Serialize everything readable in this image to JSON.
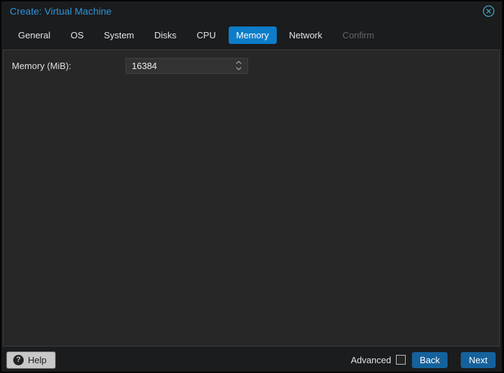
{
  "window": {
    "title": "Create: Virtual Machine"
  },
  "icons": {
    "close": "circle-x",
    "help": "question-circle",
    "spinner_up": "chevron-up",
    "spinner_down": "chevron-down"
  },
  "tabs": [
    {
      "label": "General",
      "state": "normal"
    },
    {
      "label": "OS",
      "state": "normal"
    },
    {
      "label": "System",
      "state": "normal"
    },
    {
      "label": "Disks",
      "state": "normal"
    },
    {
      "label": "CPU",
      "state": "normal"
    },
    {
      "label": "Memory",
      "state": "active"
    },
    {
      "label": "Network",
      "state": "normal"
    },
    {
      "label": "Confirm",
      "state": "disabled"
    }
  ],
  "form": {
    "memory_label": "Memory (MiB):",
    "memory_value": "16384"
  },
  "footer": {
    "help_label": "Help",
    "help_glyph": "?",
    "advanced_label": "Advanced",
    "advanced_checked": false,
    "back_label": "Back",
    "next_label": "Next"
  },
  "colors": {
    "title_blue": "#2e93d6",
    "active_tab_blue": "#0d7cc9",
    "button_blue": "#15619c",
    "close_icon_teal": "#4aa3c2",
    "content_bg": "#272727",
    "window_bg": "#1a1c1e"
  }
}
